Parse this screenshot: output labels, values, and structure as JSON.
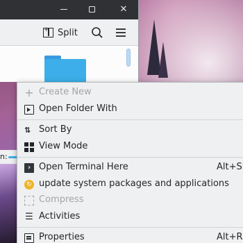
{
  "colors": {
    "accent": "#3daee9",
    "menu_bg": "#eff0f1",
    "titlebar_bg": "#2f3135",
    "text": "#232629",
    "disabled_text": "#a3a5a7"
  },
  "window": {
    "titlebar_buttons": [
      "minimize-icon",
      "maximize-icon",
      "close-icon"
    ],
    "toolbar": {
      "split_label": "Split",
      "split_icon": "split-view-icon",
      "search_icon": "search-icon",
      "menu_icon": "hamburger-menu-icon"
    },
    "content": {
      "folder_icon": "folder-icon"
    }
  },
  "sliver": {
    "label": "n:"
  },
  "context_menu": {
    "items": [
      {
        "label": "Create New",
        "icon": "plus-icon",
        "enabled": false
      },
      {
        "label": "Open Folder With",
        "icon": "open-with-icon",
        "enabled": true
      },
      {
        "label": "Sort By",
        "icon": "sort-icon",
        "enabled": true
      },
      {
        "label": "View Mode",
        "icon": "view-mode-grid-icon",
        "enabled": true
      },
      {
        "label": "Open Terminal Here",
        "icon": "terminal-icon",
        "shortcut": "Alt+Sh",
        "enabled": true
      },
      {
        "label": "update system packages and applications",
        "icon": "update-icon",
        "enabled": true
      },
      {
        "label": "Compress",
        "icon": "compress-icon",
        "enabled": false
      },
      {
        "label": "Activities",
        "icon": "activities-icon",
        "enabled": true
      },
      {
        "label": "Properties",
        "icon": "properties-icon",
        "shortcut": "Alt+R",
        "enabled": true
      }
    ]
  }
}
